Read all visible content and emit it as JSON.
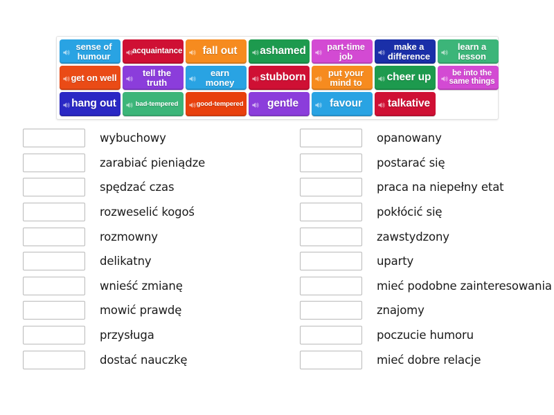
{
  "activity": {
    "type": "match-up",
    "tile_bank": {
      "rows": [
        [
          {
            "label": "sense of humour",
            "color": "#29a3e3",
            "size": "fs-md",
            "icon": "speaker-icon"
          },
          {
            "label": "acquaintance",
            "color": "#cf1034",
            "size": "fs-sm",
            "icon": "speaker-icon"
          },
          {
            "label": "fall out",
            "color": "#f68b1f",
            "size": "fs-lg",
            "icon": "speaker-icon"
          },
          {
            "label": "ashamed",
            "color": "#1d9a4e",
            "size": "fs-lg",
            "icon": "speaker-icon"
          },
          {
            "label": "part-time job",
            "color": "#d34ad3",
            "size": "fs-md",
            "icon": "speaker-icon"
          },
          {
            "label": "make a difference",
            "color": "#1a2fa8",
            "size": "fs-md",
            "icon": "speaker-icon"
          },
          {
            "label": "learn a lesson",
            "color": "#3cb579",
            "size": "fs-md",
            "icon": "speaker-icon"
          }
        ],
        [
          {
            "label": "get on well",
            "color": "#ea4b16",
            "size": "fs-md",
            "icon": "speaker-icon"
          },
          {
            "label": "tell the truth",
            "color": "#8b3ddb",
            "size": "fs-md",
            "icon": "speaker-icon"
          },
          {
            "label": "earn money",
            "color": "#29a3e3",
            "size": "fs-md",
            "icon": "speaker-icon"
          },
          {
            "label": "stubborn",
            "color": "#cf1034",
            "size": "fs-lg",
            "icon": "speaker-icon"
          },
          {
            "label": "put your mind to",
            "color": "#f68b1f",
            "size": "fs-md",
            "icon": "speaker-icon"
          },
          {
            "label": "cheer up",
            "color": "#1d9a4e",
            "size": "fs-lg",
            "icon": "speaker-icon"
          },
          {
            "label": "be into the same things",
            "color": "#d34ad3",
            "size": "fs-sm",
            "icon": "speaker-icon"
          }
        ],
        [
          {
            "label": "hang out",
            "color": "#2a28c4",
            "size": "fs-lg",
            "icon": "speaker-icon"
          },
          {
            "label": "bad-tempered",
            "color": "#3cb579",
            "size": "fs-xs",
            "icon": "speaker-icon"
          },
          {
            "label": "good-tempered",
            "color": "#e8400d",
            "size": "fs-xs",
            "icon": "speaker-icon"
          },
          {
            "label": "gentle",
            "color": "#8b3ddb",
            "size": "fs-lg",
            "icon": "speaker-icon"
          },
          {
            "label": "favour",
            "color": "#29a3e3",
            "size": "fs-lg",
            "icon": "speaker-icon"
          },
          {
            "label": "talkative",
            "color": "#cf1034",
            "size": "fs-lg",
            "icon": "speaker-icon"
          },
          {
            "label": "",
            "color": "transparent",
            "size": "fs-md",
            "empty": true
          }
        ]
      ]
    },
    "answers": {
      "left_column": [
        {
          "text": "wybuchowy",
          "box_value": ""
        },
        {
          "text": "zarabiać pieniądze",
          "box_value": ""
        },
        {
          "text": "spędzać czas",
          "box_value": ""
        },
        {
          "text": "rozweselić kogoś",
          "box_value": ""
        },
        {
          "text": "rozmowny",
          "box_value": ""
        },
        {
          "text": "delikatny",
          "box_value": ""
        },
        {
          "text": "wnieść zmianę",
          "box_value": ""
        },
        {
          "text": "mowić prawdę",
          "box_value": ""
        },
        {
          "text": "przysługa",
          "box_value": ""
        },
        {
          "text": "dostać nauczkę",
          "box_value": ""
        }
      ],
      "right_column": [
        {
          "text": "opanowany",
          "box_value": ""
        },
        {
          "text": "postarać się",
          "box_value": ""
        },
        {
          "text": "praca na niepełny etat",
          "box_value": ""
        },
        {
          "text": "pokłócić się",
          "box_value": ""
        },
        {
          "text": "zawstydzony",
          "box_value": ""
        },
        {
          "text": "uparty",
          "box_value": ""
        },
        {
          "text": "mieć podobne zainteresowania",
          "box_value": ""
        },
        {
          "text": "znajomy",
          "box_value": ""
        },
        {
          "text": "poczucie humoru",
          "box_value": ""
        },
        {
          "text": "mieć dobre relacje",
          "box_value": ""
        }
      ]
    }
  }
}
